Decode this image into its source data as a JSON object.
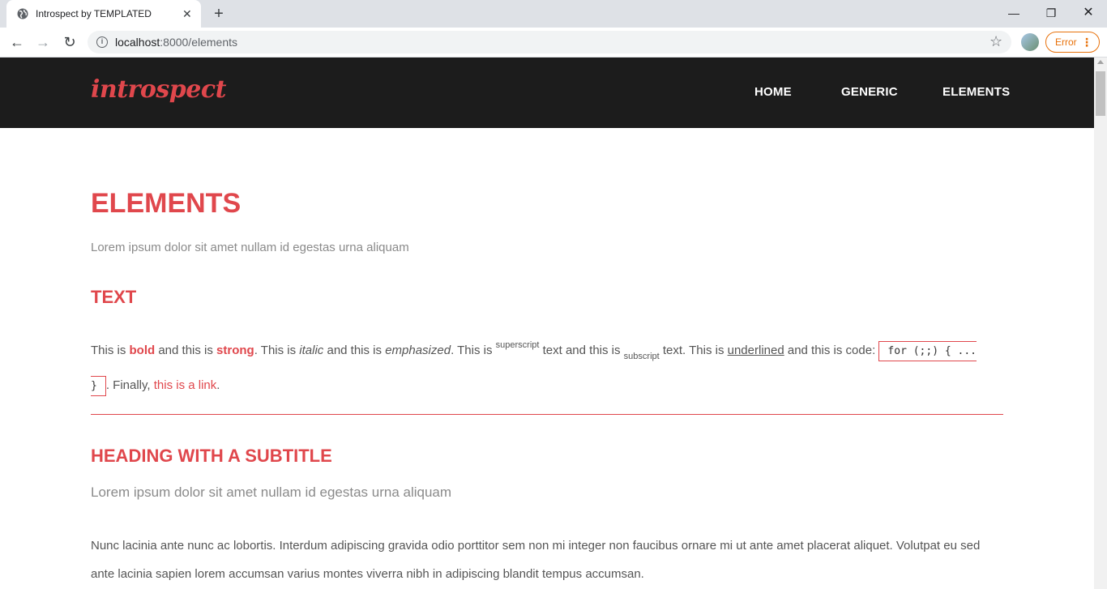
{
  "browser": {
    "tab_title": "Introspect by TEMPLATED",
    "url_host": "localhost",
    "url_path": ":8000/elements",
    "error_label": "Error"
  },
  "site": {
    "logo": "introspect",
    "nav": [
      "HOME",
      "GENERIC",
      "ELEMENTS"
    ],
    "accent_color": "#e0474c",
    "header_color": "#1c1c1c"
  },
  "page": {
    "title": "ELEMENTS",
    "subtitle": "Lorem ipsum dolor sit amet nullam id egestas urna aliquam",
    "text_heading": "TEXT",
    "text_para": {
      "p1": "This is ",
      "bold": "bold",
      "p2": " and this is ",
      "strong": "strong",
      "p3": ". This is ",
      "italic": "italic",
      "p4": " and this is ",
      "emphasized": "emphasized",
      "p5": ". This is ",
      "superscript": "superscript",
      "p6": " text and this is ",
      "subscript": "subscript",
      "p7": " text. This is ",
      "underlined": "underlined",
      "p8": " and this is code: ",
      "code": "for (;;) { ... }",
      "p9": ". Finally, ",
      "link": "this is a link",
      "p10": "."
    },
    "subtitle_heading": "HEADING WITH A SUBTITLE",
    "subtitle_text": "Lorem ipsum dolor sit amet nullam id egestas urna aliquam",
    "body_para": "Nunc lacinia ante nunc ac lobortis. Interdum adipiscing gravida odio porttitor sem non mi integer non faucibus ornare mi ut ante amet placerat aliquet. Volutpat eu sed ante lacinia sapien lorem accumsan varius montes viverra nibh in adipiscing blandit tempus accumsan."
  }
}
